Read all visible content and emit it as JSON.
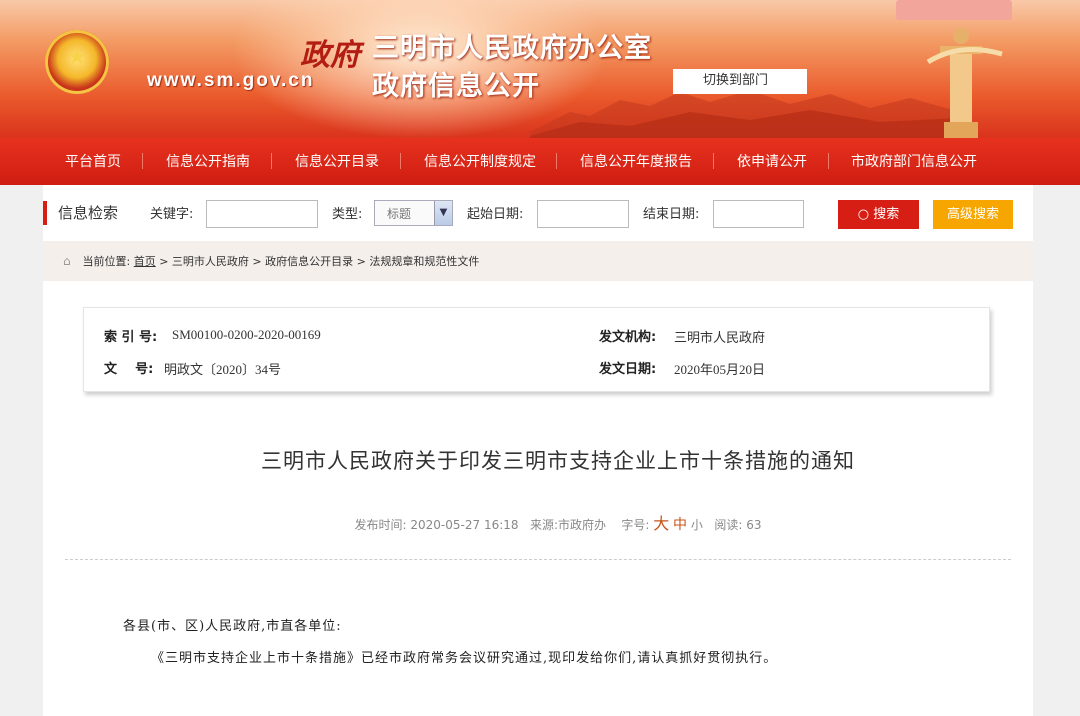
{
  "header": {
    "url": "www.sm.gov.cn",
    "partial_text": "政府",
    "title_line1": "三明市人民政府办公室",
    "title_line2": "政府信息公开",
    "switch_label": "切换到部门"
  },
  "nav": {
    "items": [
      "平台首页",
      "信息公开指南",
      "信息公开目录",
      "信息公开制度规定",
      "信息公开年度报告",
      "依申请公开",
      "市政府部门信息公开"
    ]
  },
  "search": {
    "title": "信息检索",
    "keyword_label": "关键字:",
    "keyword_value": "",
    "type_label": "类型:",
    "type_selected": "标题",
    "start_label": "起始日期:",
    "start_value": "",
    "end_label": "结束日期:",
    "end_value": "",
    "search_button": "搜索",
    "advanced_button": "高级搜索"
  },
  "breadcrumb": {
    "prefix": "当前位置:",
    "home": "首页",
    "path": " > 三明市人民政府 > 政府信息公开目录 > 法规规章和规范性文件"
  },
  "meta": {
    "index_label": "索 引 号:",
    "index_value": "SM00100-0200-2020-00169",
    "issuer_label": "发文机构:",
    "issuer_value": "三明市人民政府",
    "docno_label": "文    号:",
    "docno_value": "明政文〔2020〕34号",
    "date_label": "发文日期:",
    "date_value": "2020年05月20日"
  },
  "article": {
    "title": "三明市人民政府关于印发三明市支持企业上市十条措施的通知",
    "pub_time_label": "发布时间:",
    "pub_time": "2020-05-27 16:18",
    "source_label": "来源:",
    "source": "市政府办",
    "font_label": "字号:",
    "font_large": "大",
    "font_medium": "中",
    "font_small": "小",
    "views_label": "阅读:",
    "views": "63",
    "para1": "各县(市、区)人民政府,市直各单位:",
    "para2": "《三明市支持企业上市十条措施》已经市政府常务会议研究通过,现印发给你们,请认真抓好贯彻执行。"
  },
  "colors": {
    "primary_red": "#d71e14",
    "nav_red": "#e6321e",
    "advanced_orange": "#f7a600"
  }
}
